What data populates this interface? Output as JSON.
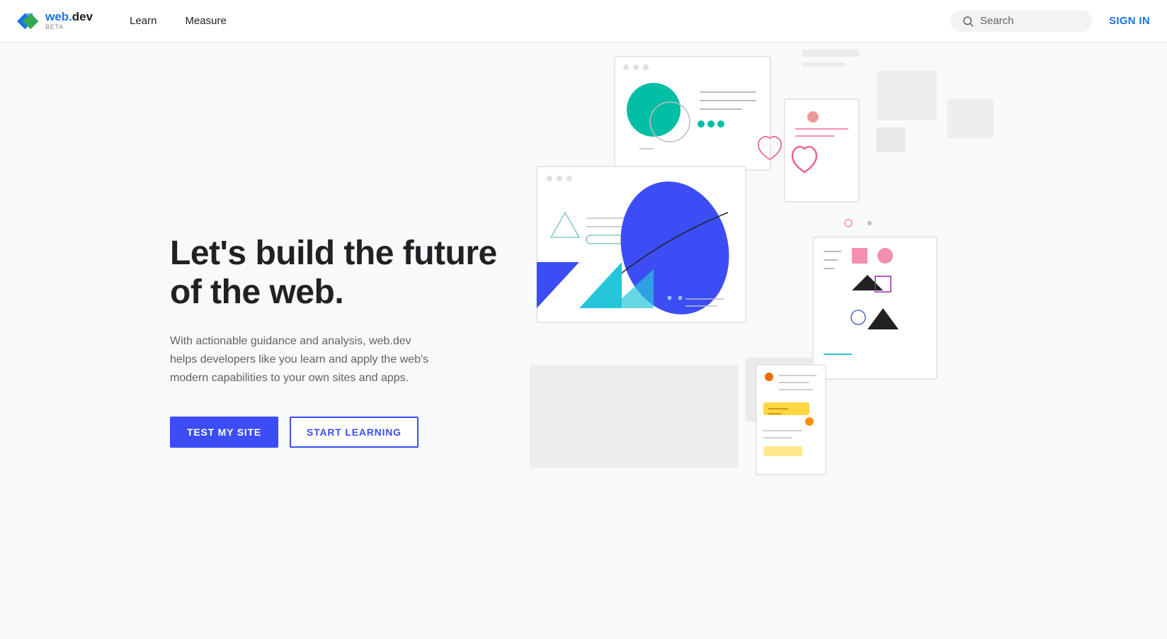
{
  "navbar": {
    "logo": {
      "web": "web",
      "dot": ".",
      "dev": "dev",
      "beta": "BETA"
    },
    "nav_items": [
      {
        "label": "Learn",
        "id": "learn"
      },
      {
        "label": "Measure",
        "id": "measure"
      }
    ],
    "search": {
      "placeholder": "Search",
      "icon": "search-icon"
    },
    "sign_in": "SIGN IN"
  },
  "hero": {
    "title": "Let's build the future of the web.",
    "subtitle": "With actionable guidance and analysis, web.dev helps developers like you learn and apply the web's modern capabilities to your own sites and apps.",
    "cta_primary": "TEST MY SITE",
    "cta_secondary": "START LEARNING"
  },
  "colors": {
    "primary_blue": "#3c4df6",
    "teal": "#00bfa5",
    "pink": "#f06292",
    "blue_dark": "#3333cc",
    "cyan": "#4dd0e1",
    "yellow": "#ffd740",
    "orange": "#ff6d00"
  }
}
